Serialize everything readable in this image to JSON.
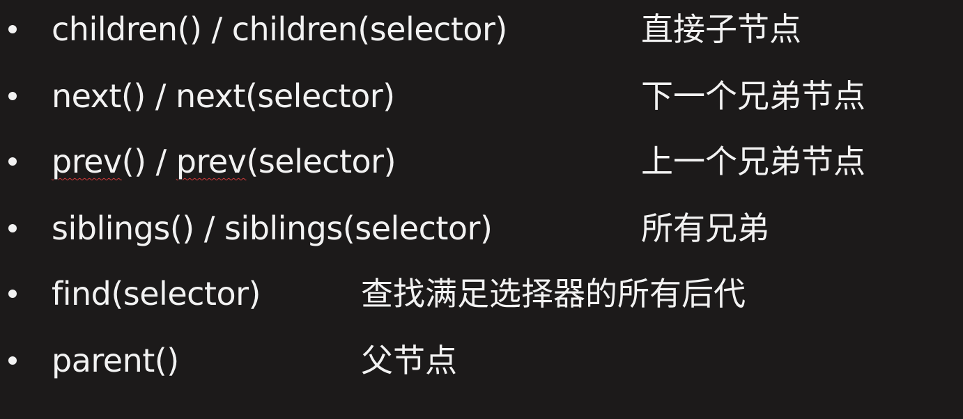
{
  "items": [
    {
      "method": "children() / children(selector)",
      "desc": "直接子节点"
    },
    {
      "method": "next() / next(selector)",
      "desc": "下一个兄弟节点"
    },
    {
      "method_part1": "prev",
      "method_part2": "() / ",
      "method_part3": "prev",
      "method_part4": "(selector)",
      "desc": "上一个兄弟节点"
    },
    {
      "method": "siblings() / siblings(selector)",
      "desc": "所有兄弟"
    },
    {
      "method": "find(selector)",
      "desc": "查找满足选择器的所有后代"
    },
    {
      "method": "parent()",
      "desc": "父节点"
    }
  ]
}
